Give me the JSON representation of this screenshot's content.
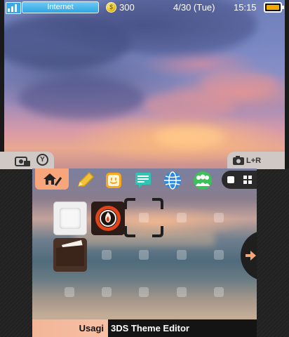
{
  "status_bar": {
    "connection_label": "Internet",
    "coin_count": "300",
    "date": "4/30 (Tue)",
    "time": "15:15",
    "battery_level": 1.0
  },
  "bezel": {
    "camera_tab_label": "Y",
    "photo_tab_label": "L+R"
  },
  "toolbar": {
    "tools": [
      "home-settings-icon",
      "pencil-icon",
      "smiley-icon",
      "chat-icon",
      "globe-icon",
      "friends-icon"
    ],
    "view_options": [
      "square-icon",
      "grid-icon"
    ]
  },
  "home_menu": {
    "icons": [
      "blank-app-icon",
      "flame-app-icon",
      "folder-icon"
    ]
  },
  "bottom_bar": {
    "user_name": "Usagi",
    "title": "3DS Theme Editor"
  },
  "colors": {
    "accent": "#f7a57a",
    "internet_blue": "#2fa4e4",
    "battery": "#f5a800"
  }
}
